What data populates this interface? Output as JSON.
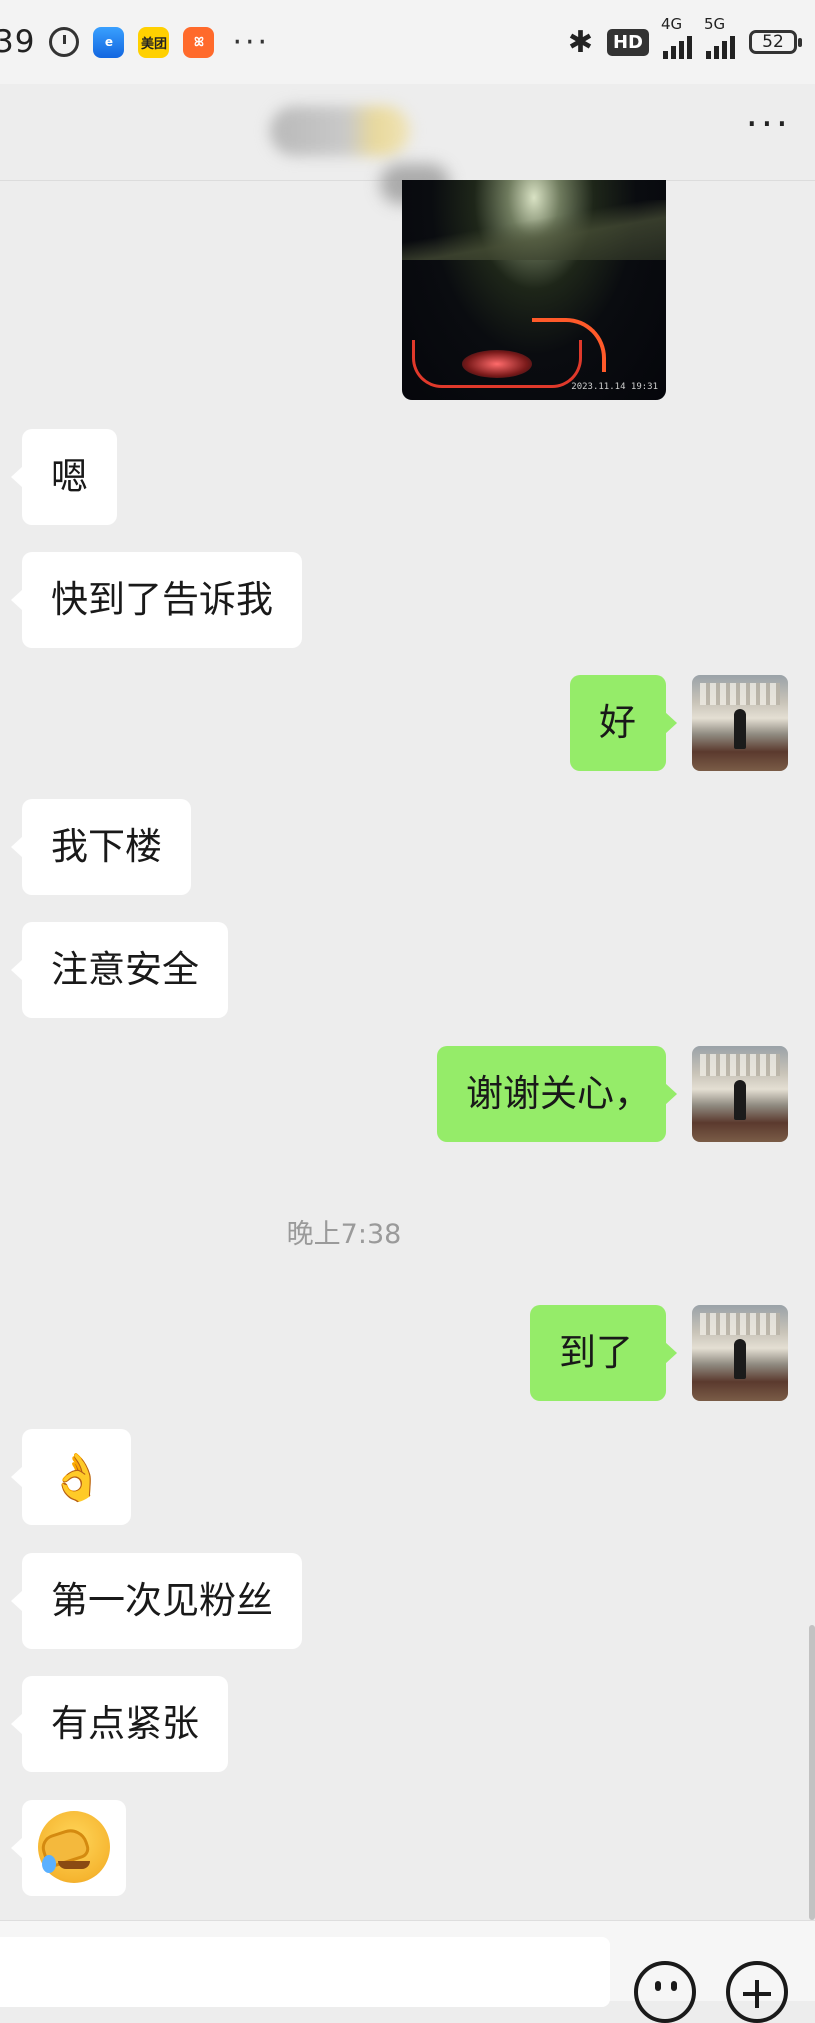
{
  "status_bar": {
    "time": "39",
    "meituan_label": "美团",
    "more_dots": "···",
    "hd_label": "HD",
    "network_4g": "4G",
    "network_5g": "5G",
    "battery": "52"
  },
  "nav": {
    "title": "",
    "more": "···"
  },
  "chat": {
    "photo_timestamp": "2023.11.14  19:31",
    "messages": [
      {
        "side": "in",
        "text": "嗯"
      },
      {
        "side": "in",
        "text": "快到了告诉我"
      },
      {
        "side": "out",
        "text": "好"
      },
      {
        "side": "in",
        "text": "我下楼"
      },
      {
        "side": "in",
        "text": "注意安全"
      },
      {
        "side": "out",
        "text": "谢谢关心，"
      },
      {
        "side": "out",
        "text": "到了"
      },
      {
        "side": "in",
        "text": "👌"
      },
      {
        "side": "in",
        "text": "第一次见粉丝"
      },
      {
        "side": "in",
        "text": "有点紧张"
      }
    ],
    "time_separator": "晚上7:38",
    "last_emoji": "facepalm"
  },
  "input": {
    "placeholder": ""
  },
  "colors": {
    "background": "#ededed",
    "incoming_bubble": "#ffffff",
    "outgoing_bubble": "#95ec69"
  }
}
